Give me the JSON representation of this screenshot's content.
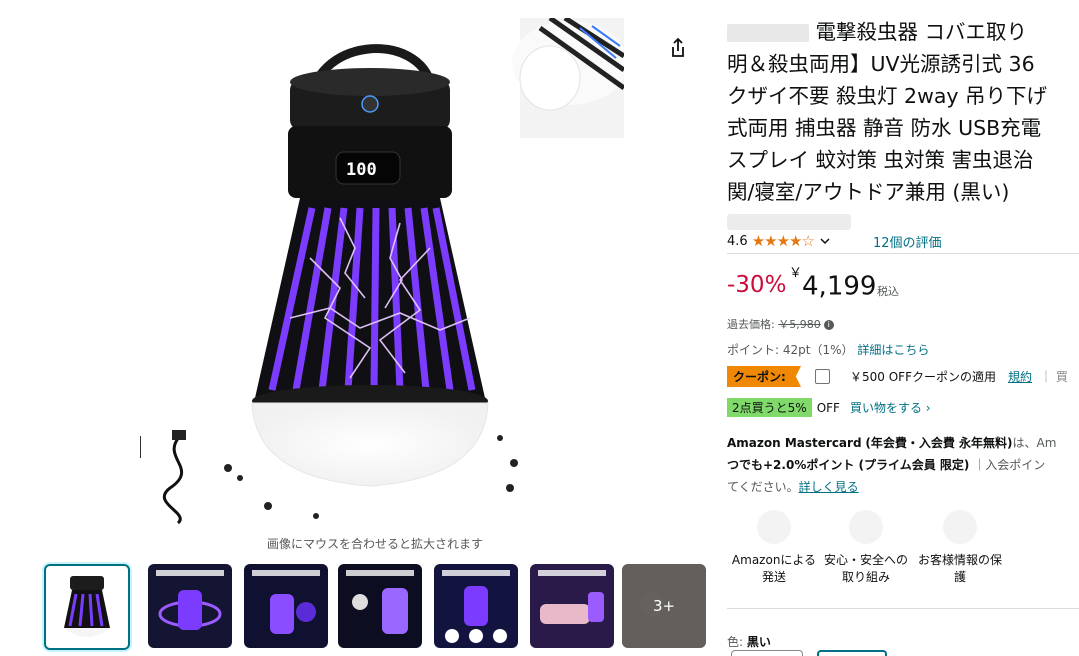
{
  "gallery": {
    "zoom_hint": "画像にマウスを合わせると拡大されます",
    "display_value": "100",
    "more_count": "3+",
    "thumbnails": [
      {
        "label": "main",
        "selected": true
      },
      {
        "label": "feature-1"
      },
      {
        "label": "feature-2"
      },
      {
        "label": "feature-3"
      },
      {
        "label": "feature-4"
      },
      {
        "label": "feature-5"
      },
      {
        "label": "more"
      }
    ]
  },
  "product": {
    "title_line1": "電撃殺虫器 コバエ取り",
    "title_rest": "明＆殺虫両用】UV光源誘引式 36\nクザイ不要 殺虫灯 2way 吊り下げ\n式両用 捕虫器 静音 防水 USB充電\nスプレイ 蚊対策 虫対策 害虫退治\n関/寝室/アウトドア兼用 (黒い)",
    "rating": "4.6",
    "stars": "★★★★☆",
    "review_count": "12個の評価"
  },
  "pricing": {
    "discount": "-30%",
    "currency": "￥",
    "price": "4,199",
    "tax_label": "税込",
    "list_price_label": "過去価格:",
    "list_price": "￥5,980",
    "points_label": "ポイント:",
    "points_value": "42pt（1%）",
    "points_link": "詳細はこちら"
  },
  "coupon": {
    "badge": "クーポン:",
    "text": "￥500 OFFクーポンの適用",
    "terms_link": "規約",
    "trailing": "｜ 買"
  },
  "bulk": {
    "badge": "2点買うと5%",
    "off": "OFF",
    "shop_link": "買い物をする ›"
  },
  "card": {
    "name": "Amazon Mastercard",
    "bold_fee": "(年会費・入会費 永年無料)",
    "text1": "は、Am",
    "line2_bold": "つでも+2.0%ポイント (プライム会員 限定)",
    "line2_rest": "｜入会ポイン",
    "line3": "てください。",
    "detail_link": "詳しく見る"
  },
  "trust": [
    {
      "label": "Amazonによる発送"
    },
    {
      "label": "安心・安全への取り組み"
    },
    {
      "label": "お客様情報の保護"
    }
  ],
  "variation": {
    "label": "色:",
    "value": "黒い"
  },
  "colors": {
    "link": "#007185",
    "discount": "#cc0c39",
    "coupon": "#f08804",
    "bulk": "#7fda69",
    "star": "#e47911",
    "uv_purple": "#7b3cff"
  }
}
